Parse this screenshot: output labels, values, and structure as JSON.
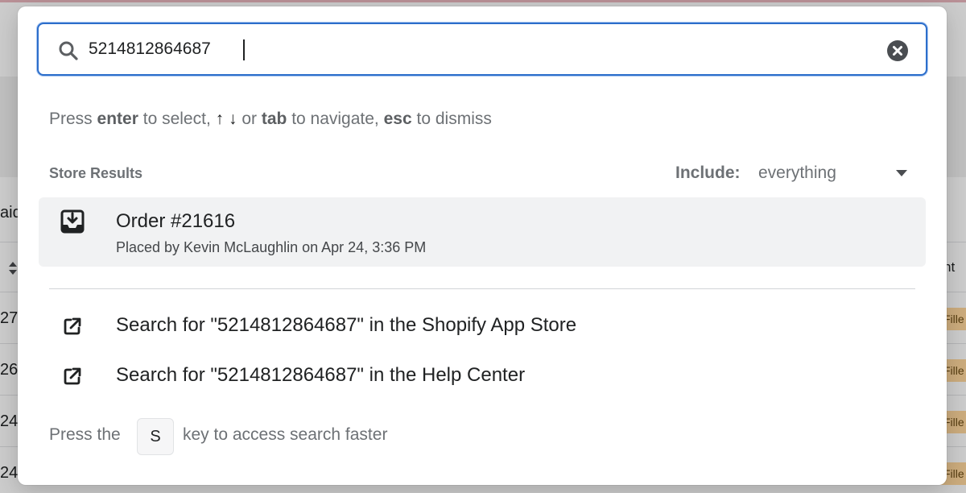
{
  "search": {
    "value": "5214812864687",
    "clear_label": "Clear search"
  },
  "hint": {
    "press": "Press",
    "enter": "enter",
    "to_select": "to select,",
    "arrows": "↑ ↓",
    "or": "or",
    "tab": "tab",
    "to_navigate": "to navigate,",
    "esc": "esc",
    "to_dismiss": "to dismiss"
  },
  "results": {
    "section_label": "Store Results",
    "include_label": "Include:",
    "include_value": "everything",
    "order": {
      "title": "Order #21616",
      "subtitle": "Placed by Kevin McLaughlin on Apr 24, 3:36 PM",
      "icon": "order-download-icon"
    }
  },
  "external_links": [
    {
      "label": "Search for \"5214812864687\" in the Shopify App Store",
      "icon": "external-link-icon"
    },
    {
      "label": "Search for \"5214812864687\" in the Help Center",
      "icon": "external-link-icon"
    }
  ],
  "footer": {
    "pre": "Press the",
    "key": "S",
    "post": "key to access search faster"
  },
  "background": {
    "fragments": [
      "aid",
      "27",
      "26",
      "24",
      "24"
    ],
    "right_header": "nt",
    "badges": [
      "Fille",
      "Fille",
      "Fille",
      "Fille"
    ]
  },
  "colors": {
    "focus_border": "#2c6ecb",
    "selected_row": "#f1f2f3",
    "badge": "#ffd79d"
  }
}
